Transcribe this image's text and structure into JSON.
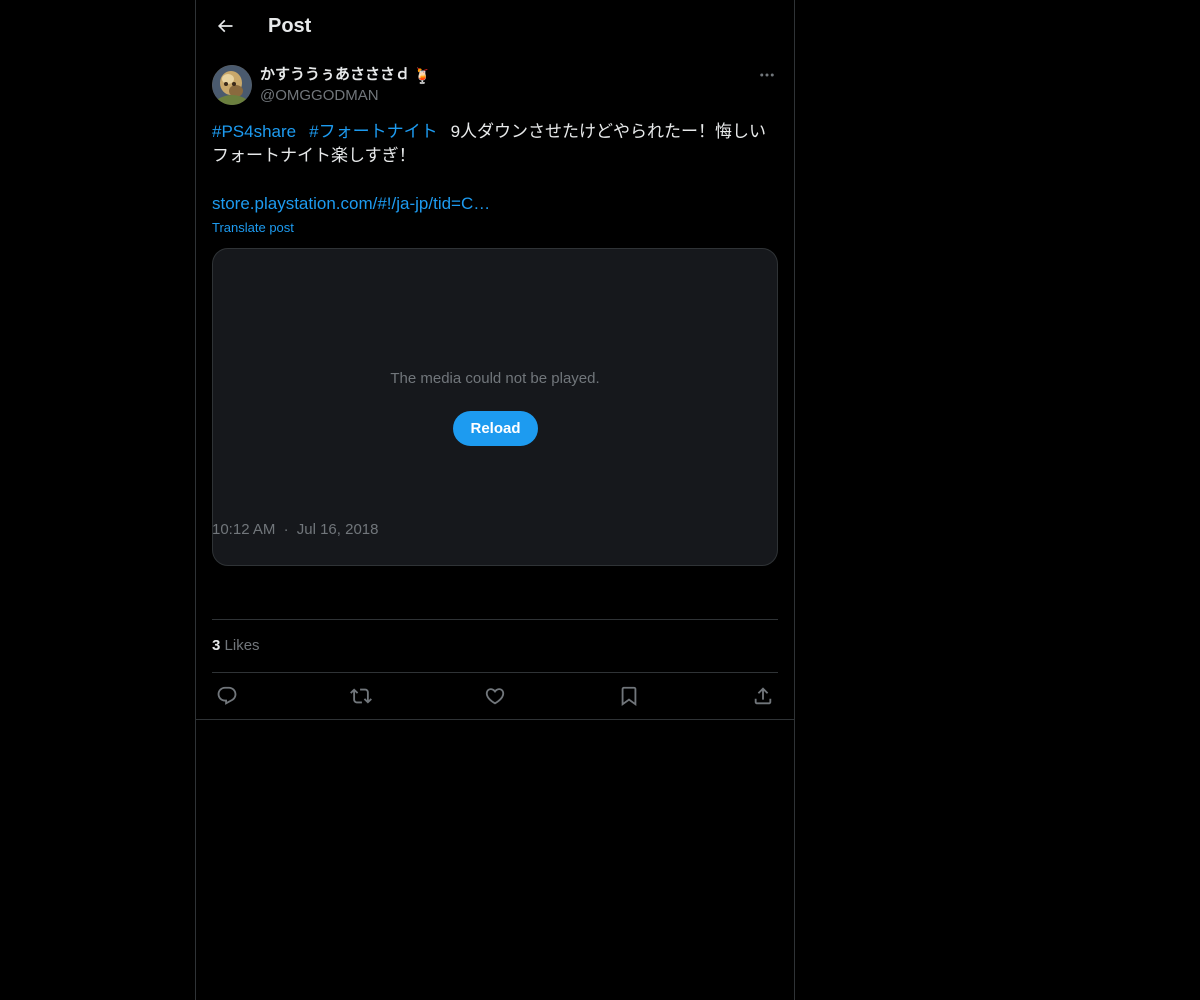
{
  "header": {
    "title": "Post",
    "back_icon": "arrow-left-icon"
  },
  "post": {
    "author": {
      "display_name": "かすううぅあさささｄ",
      "name_emoji": "🍹",
      "handle": "@OMGGODMAN"
    },
    "text": {
      "hashtag_1": "#PS4share",
      "hashtag_2": "#フォートナイト",
      "body_line_1": "9人ダウンさせたけどやられたー！悔しい",
      "body_line_2": "フォートナイト楽しすぎ！",
      "link": "store.playstation.com/#!/ja-jp/tid=C…"
    },
    "translate_label": "Translate post",
    "media": {
      "message": "The media could not be played.",
      "reload_label": "Reload"
    },
    "time": "10:12 AM",
    "separator": "·",
    "date": "Jul 16, 2018",
    "likes": {
      "count": "3",
      "label": "Likes"
    }
  },
  "actions": {
    "reply_icon": "reply-icon",
    "repost_icon": "repost-icon",
    "like_icon": "heart-icon",
    "bookmark_icon": "bookmark-icon",
    "share_icon": "share-icon"
  },
  "colors": {
    "background": "#000000",
    "text_primary": "#e7e9ea",
    "text_secondary": "#71767b",
    "accent": "#1d9bf0",
    "border": "#2f3336",
    "media_bg": "#16181c"
  }
}
